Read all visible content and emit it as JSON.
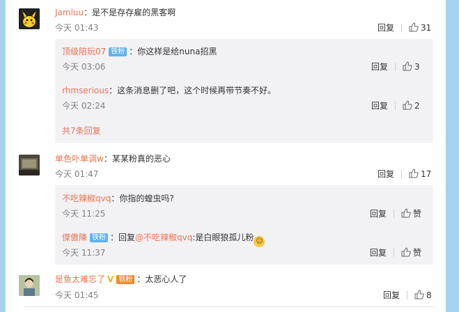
{
  "comments": [
    {
      "user": "Jamluu",
      "text": "：是不是存存雇的黑客啊",
      "time": "今天 01:43",
      "reply_label": "回复",
      "likes": "31",
      "replies": [
        {
          "user": "顶级陪玩07",
          "badge": "铁粉",
          "text": "：你这样是给nuna招黑",
          "time": "今天 03:06",
          "reply_label": "回复",
          "likes": "3"
        },
        {
          "user": "rhmserious",
          "text": "：这条消息删了吧，这个时候再带节奏不好。",
          "time": "今天 02:24",
          "reply_label": "回复",
          "likes": "2"
        }
      ],
      "more": "共7条回复"
    },
    {
      "user": "单色卟单调w",
      "text": "：某某粉真的恶心",
      "time": "今天 01:47",
      "reply_label": "回复",
      "likes": "17",
      "replies": [
        {
          "user": "不吃辣椒qvq",
          "text": "：你指的蝗虫吗?",
          "time": "今天 11:25",
          "reply_label": "回复",
          "likes": "赞"
        },
        {
          "user": "傑傲陳",
          "badge": "铁粉",
          "text_a": "：回复",
          "mention": "@不吃辣椒qvq",
          "text_b": ":是白眼狼孤儿粉",
          "time": "今天 11:37",
          "reply_label": "回复",
          "likes": "赞"
        }
      ]
    },
    {
      "user": "是鱼太难忘了",
      "badge": "铁粉",
      "text": "：太恶心人了",
      "time": "今天 01:45",
      "reply_label": "回复",
      "likes": "8"
    }
  ],
  "icons": {
    "like": "thumbs-up-icon",
    "avatar": "user-avatar",
    "emoji": "grin-emoji-icon",
    "verified": "v-verified-icon"
  },
  "colors": {
    "username": "#eb7350",
    "badge_blue": "#5fb2f0",
    "badge_orange": "#f08a2a",
    "reply_bg": "#f2f2f5",
    "page_bg": "#a5d3ef"
  }
}
